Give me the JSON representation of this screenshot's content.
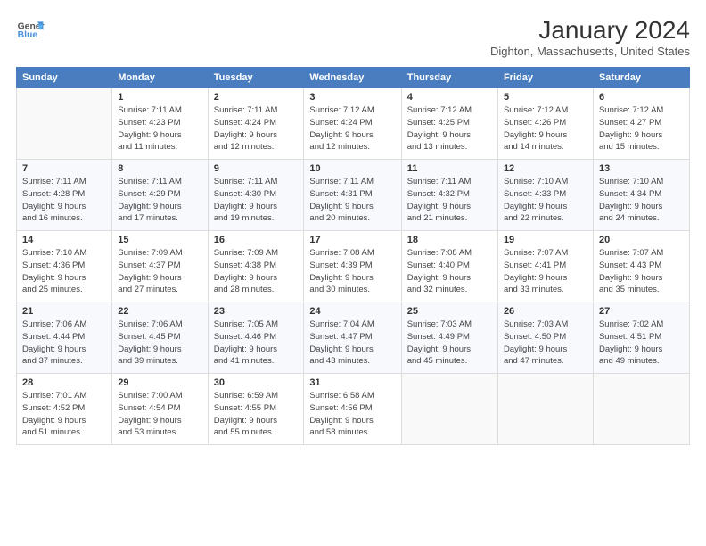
{
  "logo": {
    "line1": "General",
    "line2": "Blue"
  },
  "title": "January 2024",
  "location": "Dighton, Massachusetts, United States",
  "headers": [
    "Sunday",
    "Monday",
    "Tuesday",
    "Wednesday",
    "Thursday",
    "Friday",
    "Saturday"
  ],
  "weeks": [
    [
      {
        "day": "",
        "info": ""
      },
      {
        "day": "1",
        "info": "Sunrise: 7:11 AM\nSunset: 4:23 PM\nDaylight: 9 hours\nand 11 minutes."
      },
      {
        "day": "2",
        "info": "Sunrise: 7:11 AM\nSunset: 4:24 PM\nDaylight: 9 hours\nand 12 minutes."
      },
      {
        "day": "3",
        "info": "Sunrise: 7:12 AM\nSunset: 4:24 PM\nDaylight: 9 hours\nand 12 minutes."
      },
      {
        "day": "4",
        "info": "Sunrise: 7:12 AM\nSunset: 4:25 PM\nDaylight: 9 hours\nand 13 minutes."
      },
      {
        "day": "5",
        "info": "Sunrise: 7:12 AM\nSunset: 4:26 PM\nDaylight: 9 hours\nand 14 minutes."
      },
      {
        "day": "6",
        "info": "Sunrise: 7:12 AM\nSunset: 4:27 PM\nDaylight: 9 hours\nand 15 minutes."
      }
    ],
    [
      {
        "day": "7",
        "info": "Sunrise: 7:11 AM\nSunset: 4:28 PM\nDaylight: 9 hours\nand 16 minutes."
      },
      {
        "day": "8",
        "info": "Sunrise: 7:11 AM\nSunset: 4:29 PM\nDaylight: 9 hours\nand 17 minutes."
      },
      {
        "day": "9",
        "info": "Sunrise: 7:11 AM\nSunset: 4:30 PM\nDaylight: 9 hours\nand 19 minutes."
      },
      {
        "day": "10",
        "info": "Sunrise: 7:11 AM\nSunset: 4:31 PM\nDaylight: 9 hours\nand 20 minutes."
      },
      {
        "day": "11",
        "info": "Sunrise: 7:11 AM\nSunset: 4:32 PM\nDaylight: 9 hours\nand 21 minutes."
      },
      {
        "day": "12",
        "info": "Sunrise: 7:10 AM\nSunset: 4:33 PM\nDaylight: 9 hours\nand 22 minutes."
      },
      {
        "day": "13",
        "info": "Sunrise: 7:10 AM\nSunset: 4:34 PM\nDaylight: 9 hours\nand 24 minutes."
      }
    ],
    [
      {
        "day": "14",
        "info": "Sunrise: 7:10 AM\nSunset: 4:36 PM\nDaylight: 9 hours\nand 25 minutes."
      },
      {
        "day": "15",
        "info": "Sunrise: 7:09 AM\nSunset: 4:37 PM\nDaylight: 9 hours\nand 27 minutes."
      },
      {
        "day": "16",
        "info": "Sunrise: 7:09 AM\nSunset: 4:38 PM\nDaylight: 9 hours\nand 28 minutes."
      },
      {
        "day": "17",
        "info": "Sunrise: 7:08 AM\nSunset: 4:39 PM\nDaylight: 9 hours\nand 30 minutes."
      },
      {
        "day": "18",
        "info": "Sunrise: 7:08 AM\nSunset: 4:40 PM\nDaylight: 9 hours\nand 32 minutes."
      },
      {
        "day": "19",
        "info": "Sunrise: 7:07 AM\nSunset: 4:41 PM\nDaylight: 9 hours\nand 33 minutes."
      },
      {
        "day": "20",
        "info": "Sunrise: 7:07 AM\nSunset: 4:43 PM\nDaylight: 9 hours\nand 35 minutes."
      }
    ],
    [
      {
        "day": "21",
        "info": "Sunrise: 7:06 AM\nSunset: 4:44 PM\nDaylight: 9 hours\nand 37 minutes."
      },
      {
        "day": "22",
        "info": "Sunrise: 7:06 AM\nSunset: 4:45 PM\nDaylight: 9 hours\nand 39 minutes."
      },
      {
        "day": "23",
        "info": "Sunrise: 7:05 AM\nSunset: 4:46 PM\nDaylight: 9 hours\nand 41 minutes."
      },
      {
        "day": "24",
        "info": "Sunrise: 7:04 AM\nSunset: 4:47 PM\nDaylight: 9 hours\nand 43 minutes."
      },
      {
        "day": "25",
        "info": "Sunrise: 7:03 AM\nSunset: 4:49 PM\nDaylight: 9 hours\nand 45 minutes."
      },
      {
        "day": "26",
        "info": "Sunrise: 7:03 AM\nSunset: 4:50 PM\nDaylight: 9 hours\nand 47 minutes."
      },
      {
        "day": "27",
        "info": "Sunrise: 7:02 AM\nSunset: 4:51 PM\nDaylight: 9 hours\nand 49 minutes."
      }
    ],
    [
      {
        "day": "28",
        "info": "Sunrise: 7:01 AM\nSunset: 4:52 PM\nDaylight: 9 hours\nand 51 minutes."
      },
      {
        "day": "29",
        "info": "Sunrise: 7:00 AM\nSunset: 4:54 PM\nDaylight: 9 hours\nand 53 minutes."
      },
      {
        "day": "30",
        "info": "Sunrise: 6:59 AM\nSunset: 4:55 PM\nDaylight: 9 hours\nand 55 minutes."
      },
      {
        "day": "31",
        "info": "Sunrise: 6:58 AM\nSunset: 4:56 PM\nDaylight: 9 hours\nand 58 minutes."
      },
      {
        "day": "",
        "info": ""
      },
      {
        "day": "",
        "info": ""
      },
      {
        "day": "",
        "info": ""
      }
    ]
  ]
}
